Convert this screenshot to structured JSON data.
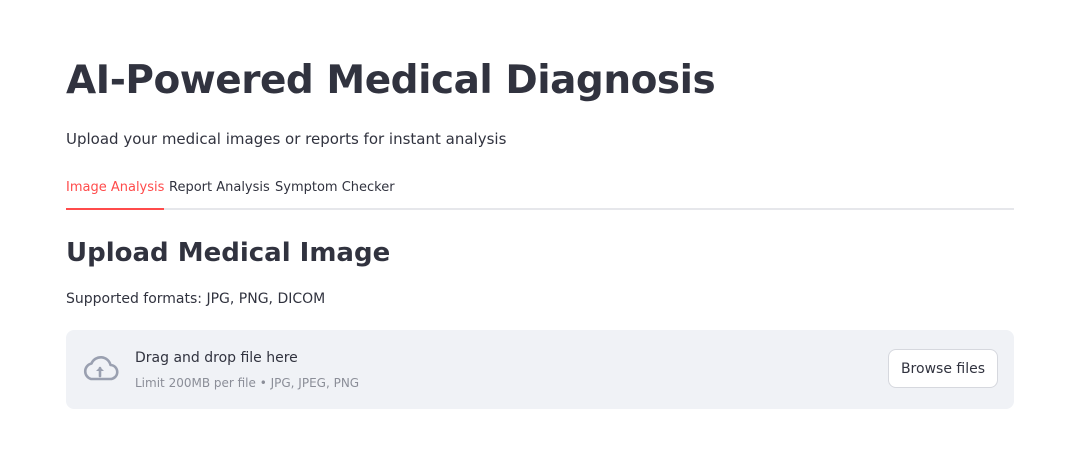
{
  "header": {
    "title": "AI-Powered Medical Diagnosis",
    "subtitle": "Upload your medical images or reports for instant analysis"
  },
  "tabs": [
    {
      "label": "Image Analysis",
      "active": true
    },
    {
      "label": "Report Analysis",
      "active": false
    },
    {
      "label": "Symptom Checker",
      "active": false
    }
  ],
  "section": {
    "title": "Upload Medical Image",
    "formats_text": "Supported formats: JPG, PNG, DICOM"
  },
  "uploader": {
    "icon": "cloud-upload-icon",
    "main_text": "Drag and drop file here",
    "sub_text": "Limit 200MB per file • JPG, JPEG, PNG",
    "button_label": "Browse files"
  },
  "colors": {
    "accent": "#ff4b4b",
    "text": "#31333f",
    "dropzone_bg": "#f0f2f6",
    "muted_text": "#8b8e98"
  }
}
